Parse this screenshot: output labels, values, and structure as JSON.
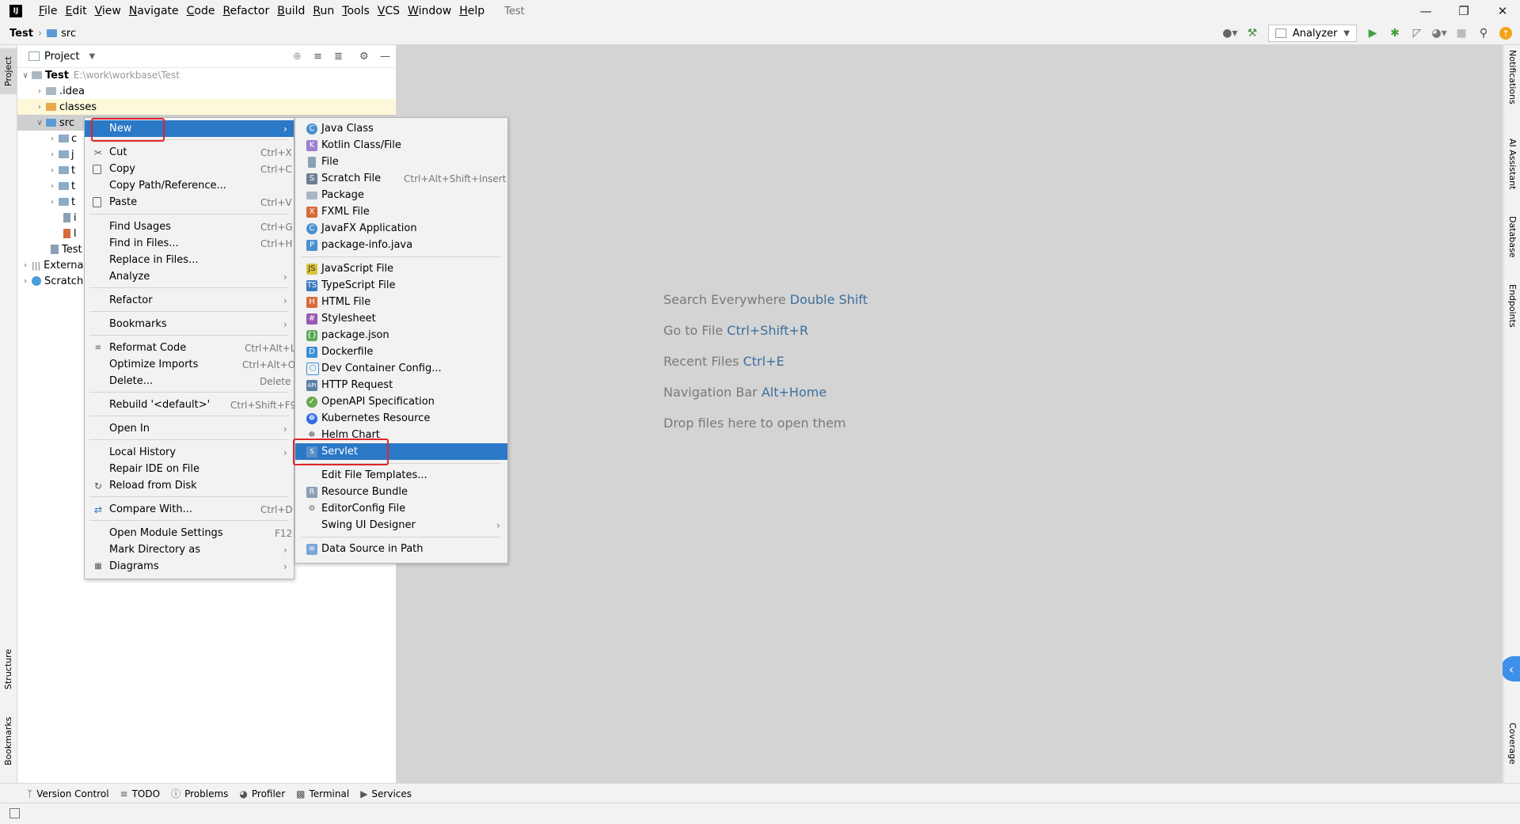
{
  "menubar": {
    "items": [
      "File",
      "Edit",
      "View",
      "Navigate",
      "Code",
      "Refactor",
      "Build",
      "Run",
      "Tools",
      "VCS",
      "Window",
      "Help"
    ],
    "title": "Test"
  },
  "navbar": {
    "project": "Test",
    "folder": "src"
  },
  "toolbar": {
    "run_config": "Analyzer"
  },
  "left_stripe": {
    "project_tab": "Project",
    "structure_tab": "Structure",
    "bookmarks_tab": "Bookmarks"
  },
  "right_stripe": {
    "notifications": "Notifications",
    "ai_assistant": "AI Assistant",
    "database": "Database",
    "endpoints": "Endpoints",
    "coverage": "Coverage"
  },
  "project_panel": {
    "title": "Project",
    "tree": {
      "root_name": "Test",
      "root_path": "E:\\work\\workbase\\Test",
      "idea": ".idea",
      "classes": "classes",
      "src": "src",
      "test_file": "Test",
      "external": "Externa",
      "scratches": "Scratch",
      "src_children": [
        "c",
        "j",
        "t",
        "t",
        "t",
        "i",
        "l"
      ]
    }
  },
  "context_menu": {
    "new": "New",
    "cut": {
      "label": "Cut",
      "shortcut": "Ctrl+X"
    },
    "copy": {
      "label": "Copy",
      "shortcut": "Ctrl+C"
    },
    "copy_path": {
      "label": "Copy Path/Reference..."
    },
    "paste": {
      "label": "Paste",
      "shortcut": "Ctrl+V"
    },
    "find_usages": {
      "label": "Find Usages",
      "shortcut": "Ctrl+G"
    },
    "find_in_files": {
      "label": "Find in Files...",
      "shortcut": "Ctrl+H"
    },
    "replace_in_files": {
      "label": "Replace in Files..."
    },
    "analyze": {
      "label": "Analyze"
    },
    "refactor": {
      "label": "Refactor"
    },
    "bookmarks": {
      "label": "Bookmarks"
    },
    "reformat": {
      "label": "Reformat Code",
      "shortcut": "Ctrl+Alt+L"
    },
    "optimize": {
      "label": "Optimize Imports",
      "shortcut": "Ctrl+Alt+O"
    },
    "delete": {
      "label": "Delete...",
      "shortcut": "Delete"
    },
    "rebuild": {
      "label": "Rebuild '<default>'",
      "shortcut": "Ctrl+Shift+F9"
    },
    "open_in": {
      "label": "Open In"
    },
    "local_history": {
      "label": "Local History"
    },
    "repair_ide": {
      "label": "Repair IDE on File"
    },
    "reload": {
      "label": "Reload from Disk"
    },
    "compare": {
      "label": "Compare With...",
      "shortcut": "Ctrl+D"
    },
    "module_settings": {
      "label": "Open Module Settings",
      "shortcut": "F12"
    },
    "mark_dir": {
      "label": "Mark Directory as"
    },
    "diagrams": {
      "label": "Diagrams"
    }
  },
  "new_submenu": {
    "java_class": "Java Class",
    "kotlin": "Kotlin Class/File",
    "file": "File",
    "scratch": {
      "label": "Scratch File",
      "shortcut": "Ctrl+Alt+Shift+Insert"
    },
    "package": "Package",
    "fxml": "FXML File",
    "javafx": "JavaFX Application",
    "package_info": "package-info.java",
    "javascript": "JavaScript File",
    "typescript": "TypeScript File",
    "html": "HTML File",
    "stylesheet": "Stylesheet",
    "package_json": "package.json",
    "dockerfile": "Dockerfile",
    "dev_container": "Dev Container Config...",
    "http": "HTTP Request",
    "openapi": "OpenAPI Specification",
    "kubernetes": "Kubernetes Resource",
    "helm": "Helm Chart",
    "servlet": "Servlet",
    "edit_templates": "Edit File Templates...",
    "resource_bundle": "Resource Bundle",
    "editorconfig": "EditorConfig File",
    "swing": "Swing UI Designer",
    "data_source": "Data Source in Path"
  },
  "editor_hints": [
    {
      "text": "Search Everywhere",
      "key": "Double Shift"
    },
    {
      "text": "Go to File",
      "key": "Ctrl+Shift+R"
    },
    {
      "text": "Recent Files",
      "key": "Ctrl+E"
    },
    {
      "text": "Navigation Bar",
      "key": "Alt+Home"
    },
    {
      "text": "Drop files here to open them",
      "key": ""
    }
  ],
  "bottom_tabs": [
    "Version Control",
    "TODO",
    "Problems",
    "Profiler",
    "Terminal",
    "Services"
  ],
  "colors": {
    "selection": "#2b78c7",
    "highlight_box": "#e0262c",
    "editor_bg": "#d4d4d4",
    "hint_key": "#3c6e9e"
  }
}
